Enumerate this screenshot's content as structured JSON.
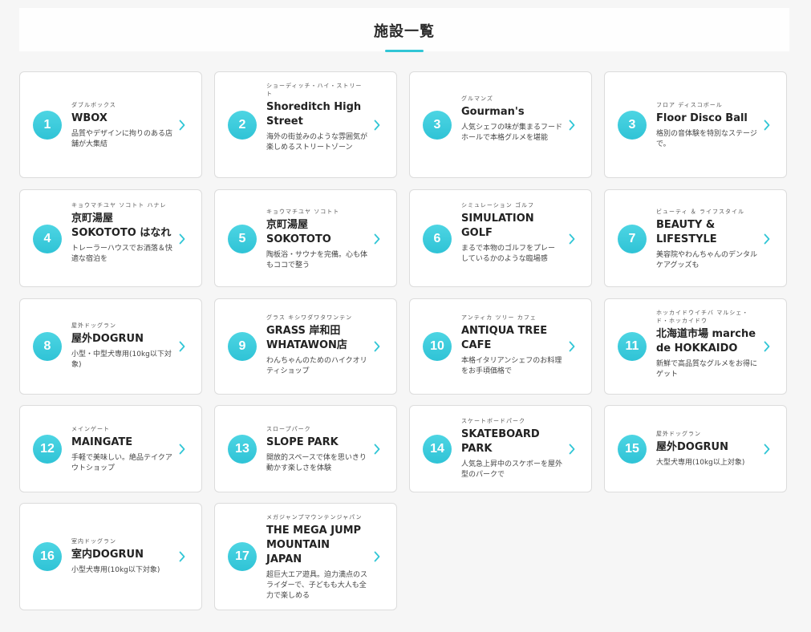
{
  "header": {
    "title": "施設一覧"
  },
  "colors": {
    "accent": "#31c6d6",
    "card_border": "#dcdcdc",
    "background": "#f6f6f6"
  },
  "icons": {
    "chevron": "chevron-right-icon"
  },
  "facilities": [
    {
      "num": "1",
      "ruby": "ダブルボックス",
      "name": "WBOX",
      "desc": "品質やデザインに拘りのある店舗が大集結"
    },
    {
      "num": "2",
      "ruby": "ショーディッチ・ハイ・ストリート",
      "name": "Shoreditch High Street",
      "desc": "海外の街並みのような雰囲気が楽しめるストリートゾーン"
    },
    {
      "num": "3",
      "ruby": "グルマンズ",
      "name": "Gourman's",
      "desc": "人気シェフの味が集まるフードホールで本格グルメを堪能"
    },
    {
      "num": "3",
      "ruby": "フロア ディスコボール",
      "name": "Floor Disco Ball",
      "desc": "格別の音体験を特別なステージで。"
    },
    {
      "num": "4",
      "ruby": "キョウマチユヤ ソコトト ハナレ",
      "name": "京町湯屋 SOKOTOTO はなれ",
      "desc": "トレーラーハウスでお洒落＆快適な宿泊を"
    },
    {
      "num": "5",
      "ruby": "キョウマチユヤ ソコトト",
      "name": "京町湯屋 SOKOTOTO",
      "desc": "陶板浴・サウナを完備。心も体もココで整う"
    },
    {
      "num": "6",
      "ruby": "シミュレーション ゴルフ",
      "name": "SIMULATION GOLF",
      "desc": "まるで本物のゴルフをプレーしているかのような臨場感"
    },
    {
      "num": "7",
      "ruby": "ビューティ ＆ ライフスタイル",
      "name": "BEAUTY & LIFESTYLE",
      "desc": "美容院やわんちゃんのデンタルケアグッズも"
    },
    {
      "num": "8",
      "ruby": "屋外ドッグラン",
      "name": "屋外DOGRUN",
      "desc": "小型・中型犬専用(10kg以下対象)"
    },
    {
      "num": "9",
      "ruby": "グラス キシワダワタワンテン",
      "name": "GRASS 岸和田 WHATAWON店",
      "desc": "わんちゃんのためのハイクオリティショップ"
    },
    {
      "num": "10",
      "ruby": "アンティカ ツリー カフェ",
      "name": "ANTIQUA TREE CAFE",
      "desc": "本格イタリアンシェフのお料理をお手頃価格で"
    },
    {
      "num": "11",
      "ruby": "ホッカイドウイチバ マルシェ・ド・ホッカイドウ",
      "name": "北海道市場 marche de HOKKAIDO",
      "desc": "新鮮で高品質なグルメをお得にゲット"
    },
    {
      "num": "12",
      "ruby": "メインゲート",
      "name": "MAINGATE",
      "desc": "手軽で美味しい。絶品テイクアウトショップ"
    },
    {
      "num": "13",
      "ruby": "スロープパーク",
      "name": "SLOPE PARK",
      "desc": "開放的スペースで体を思いきり動かす楽しさを体験"
    },
    {
      "num": "14",
      "ruby": "スケートボードパーク",
      "name": "SKATEBOARD PARK",
      "desc": "人気急上昇中のスケボーを屋外型のパークで"
    },
    {
      "num": "15",
      "ruby": "屋外ドッグラン",
      "name": "屋外DOGRUN",
      "desc": "大型犬専用(10kg以上対象)"
    },
    {
      "num": "16",
      "ruby": "室内ドッグラン",
      "name": "室内DOGRUN",
      "desc": "小型犬専用(10kg以下対象)"
    },
    {
      "num": "17",
      "ruby": "メガジャンプマウンテンジャパン",
      "name": "THE MEGA JUMP MOUNTAIN JAPAN",
      "desc": "超巨大エア遊具。迫力満点のスライダーで、子どもも大人も全力で楽しめる"
    }
  ]
}
